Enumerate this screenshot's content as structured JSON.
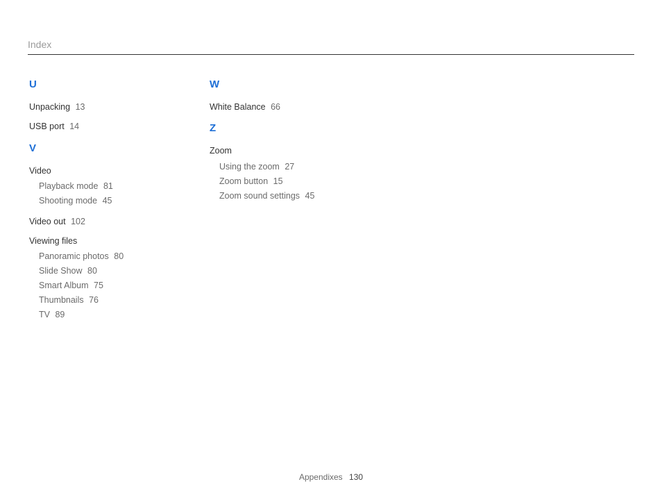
{
  "header": {
    "title": "Index"
  },
  "footer": {
    "section": "Appendixes",
    "page": "130"
  },
  "column1": {
    "letterU": "U",
    "unpacking": {
      "term": "Unpacking",
      "page": "13"
    },
    "usbPort": {
      "term": "USB port",
      "page": "14"
    },
    "letterV": "V",
    "video": {
      "term": "Video"
    },
    "videoSub": {
      "playback": {
        "term": "Playback mode",
        "page": "81"
      },
      "shooting": {
        "term": "Shooting mode",
        "page": "45"
      }
    },
    "videoOut": {
      "term": "Video out",
      "page": "102"
    },
    "viewingFiles": {
      "term": "Viewing files"
    },
    "viewingSub": {
      "pano": {
        "term": "Panoramic photos",
        "page": "80"
      },
      "slide": {
        "term": "Slide Show",
        "page": "80"
      },
      "smart": {
        "term": "Smart Album",
        "page": "75"
      },
      "thumbs": {
        "term": "Thumbnails",
        "page": "76"
      },
      "tv": {
        "term": "TV",
        "page": "89"
      }
    }
  },
  "column2": {
    "letterW": "W",
    "whiteBalance": {
      "term": "White Balance",
      "page": "66"
    },
    "letterZ": "Z",
    "zoom": {
      "term": "Zoom"
    },
    "zoomSub": {
      "using": {
        "term": "Using the zoom",
        "page": "27"
      },
      "button": {
        "term": "Zoom button",
        "page": "15"
      },
      "sound": {
        "term": "Zoom sound settings",
        "page": "45"
      }
    }
  }
}
